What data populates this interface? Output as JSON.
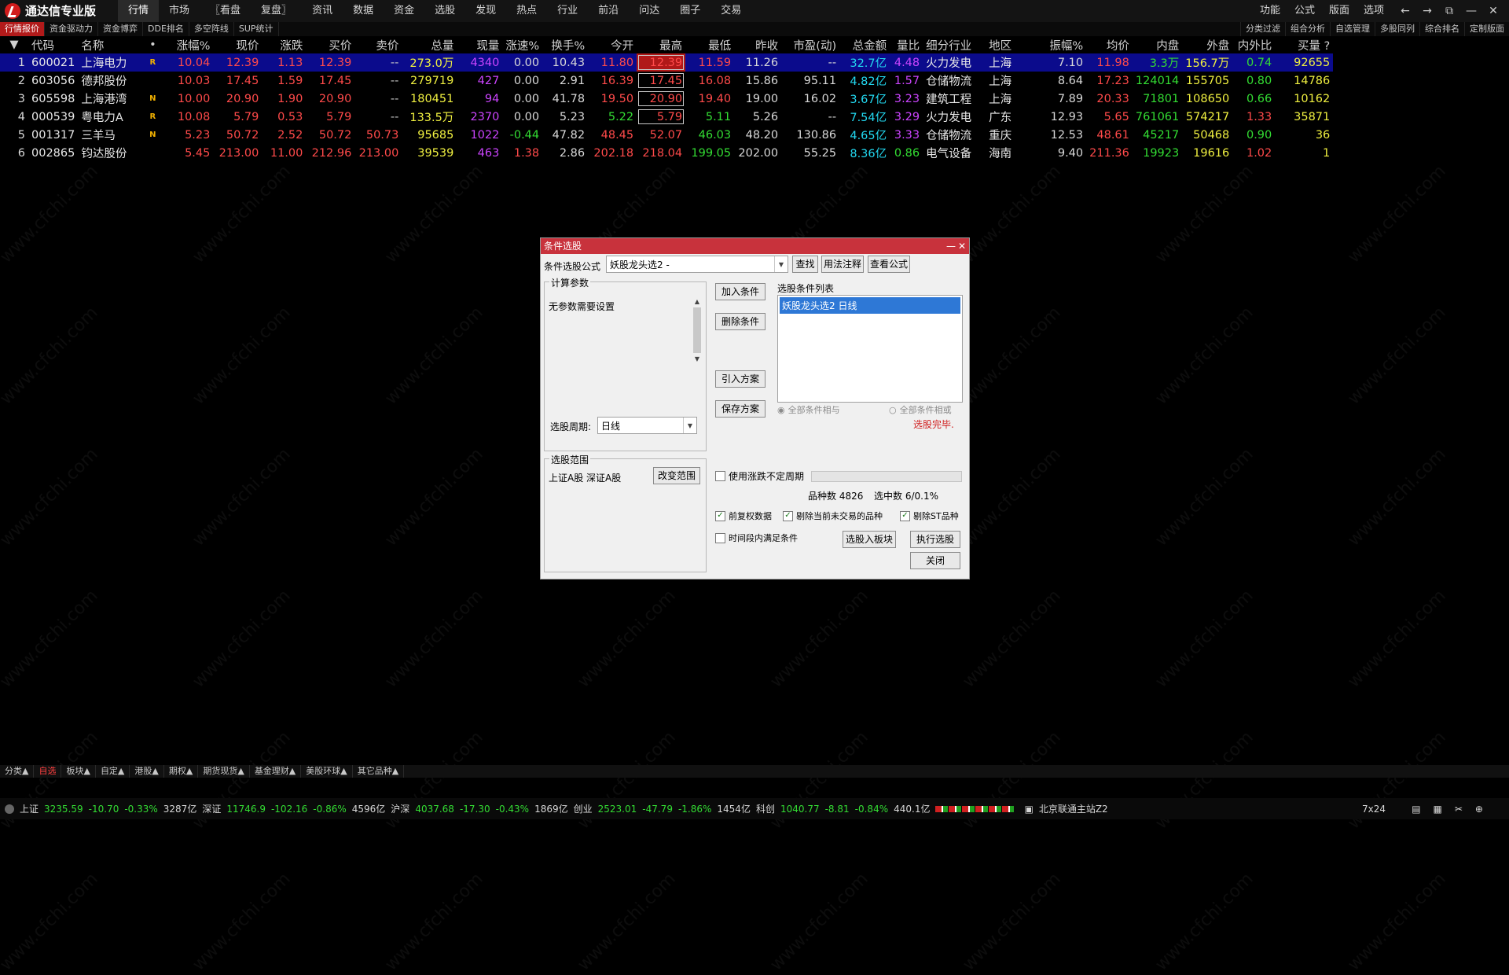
{
  "app": {
    "title": "通达信专业版"
  },
  "menu": [
    "行情",
    "市场",
    "〖看盘",
    "复盘〗",
    "资讯",
    "数据",
    "资金",
    "选股",
    "发现",
    "热点",
    "行业",
    "前沿",
    "问达",
    "圈子",
    "交易"
  ],
  "right_menu": [
    "功能",
    "公式",
    "版面",
    "选项"
  ],
  "window_buttons": [
    "←",
    "→",
    "⧉",
    "—",
    "✕"
  ],
  "tabs": [
    "行情报价",
    "资金驱动力",
    "资金博弈",
    "DDE排名",
    "多空阵线",
    "SUP统计"
  ],
  "right_tabs": [
    "分类过滤",
    "组合分析",
    "自选管理",
    "多股同列",
    "综合排名",
    "定制版面"
  ],
  "watermark": "www.cfchi.com",
  "table": {
    "headers": [
      "",
      "代码",
      "名称",
      "•",
      "涨幅%",
      "现价",
      "涨跌",
      "买价",
      "卖价",
      "总量",
      "现量",
      "涨速%",
      "换手%",
      "今开",
      "最高",
      "最低",
      "昨收",
      "市盈(动)",
      "总金额",
      "量比",
      "细分行业",
      "地区",
      "振幅%",
      "均价",
      "内盘",
      "外盘",
      "内外比",
      "买量 ?"
    ],
    "rows": [
      {
        "c": [
          "1",
          "600021",
          "上海电力",
          "R",
          "10.04",
          "12.39",
          "1.13",
          "12.39",
          "--",
          "273.0万",
          "4340",
          "0.00",
          "10.43",
          "11.80",
          "12.39",
          "11.59",
          "11.26",
          "--",
          "32.7亿",
          "4.48",
          "火力发电",
          "上海",
          "7.10",
          "11.98",
          "3.3万",
          "156.7万",
          "0.74",
          "92655"
        ]
      },
      {
        "c": [
          "2",
          "603056",
          "德邦股份",
          "",
          "10.03",
          "17.45",
          "1.59",
          "17.45",
          "--",
          "279719",
          "427",
          "0.00",
          "2.91",
          "16.39",
          "17.45",
          "16.08",
          "15.86",
          "95.11",
          "4.82亿",
          "1.57",
          "仓储物流",
          "上海",
          "8.64",
          "17.23",
          "124014",
          "155705",
          "0.80",
          "14786"
        ]
      },
      {
        "c": [
          "3",
          "605598",
          "上海港湾",
          "N",
          "10.00",
          "20.90",
          "1.90",
          "20.90",
          "--",
          "180451",
          "94",
          "0.00",
          "41.78",
          "19.50",
          "20.90",
          "19.40",
          "19.00",
          "16.02",
          "3.67亿",
          "3.23",
          "建筑工程",
          "上海",
          "7.89",
          "20.33",
          "71801",
          "108650",
          "0.66",
          "10162"
        ]
      },
      {
        "c": [
          "4",
          "000539",
          "粤电力A",
          "R",
          "10.08",
          "5.79",
          "0.53",
          "5.79",
          "--",
          "133.5万",
          "2370",
          "0.00",
          "5.23",
          "5.22",
          "5.79",
          "5.11",
          "5.26",
          "--",
          "7.54亿",
          "3.29",
          "火力发电",
          "广东",
          "12.93",
          "5.65",
          "761061",
          "574217",
          "1.33",
          "35871"
        ]
      },
      {
        "c": [
          "5",
          "001317",
          "三羊马",
          "N",
          "5.23",
          "50.72",
          "2.52",
          "50.72",
          "50.73",
          "95685",
          "1022",
          "-0.44",
          "47.82",
          "48.45",
          "52.07",
          "46.03",
          "48.20",
          "130.86",
          "4.65亿",
          "3.33",
          "仓储物流",
          "重庆",
          "12.53",
          "48.61",
          "45217",
          "50468",
          "0.90",
          "36"
        ]
      },
      {
        "c": [
          "6",
          "002865",
          "钧达股份",
          "",
          "5.45",
          "213.00",
          "11.00",
          "212.96",
          "213.00",
          "39539",
          "463",
          "1.38",
          "2.86",
          "202.18",
          "218.04",
          "199.05",
          "202.00",
          "55.25",
          "8.36亿",
          "0.86",
          "电气设备",
          "海南",
          "9.40",
          "211.36",
          "19923",
          "19616",
          "1.02",
          "1"
        ]
      }
    ]
  },
  "dialog": {
    "title": "条件选股",
    "formula_label": "条件选股公式",
    "formula_value": "妖股龙头选2  -",
    "find_btn": "查找",
    "usage_btn": "用法注释",
    "view_btn": "查看公式",
    "params_title": "计算参数",
    "params_text": "无参数需要设置",
    "add_btn": "加入条件",
    "del_btn": "删除条件",
    "import_btn": "引入方案",
    "save_btn": "保存方案",
    "list_title": "选股条件列表",
    "list_items": [
      "妖股龙头选2  日线"
    ],
    "radio_and": "全部条件相与",
    "radio_or": "全部条件相或",
    "done_text": "选股完毕.",
    "period_label": "选股周期:",
    "period_value": "日线",
    "range_title": "选股范围",
    "range_text": "上证A股 深证A股",
    "change_range_btn": "改变范围",
    "use_period_label": "使用涨跌不定周期",
    "count_text": "品种数 4826",
    "selected_text": "选中数 6/0.1%",
    "opt_prefq": "前复权数据",
    "opt_remove_untraded": "剔除当前未交易的品种",
    "opt_remove_st": "剔除ST品种",
    "opt_time_range": "时间段内满足条件",
    "to_block_btn": "选股入板块",
    "exec_btn": "执行选股",
    "close_btn": "关闭"
  },
  "bottom_tabs": [
    "分类▲",
    "自选",
    "板块▲",
    "自定▲",
    "港股▲",
    "期权▲",
    "期货现货▲",
    "基金理财▲",
    "美股环球▲",
    "其它品种▲"
  ],
  "status": {
    "sh_label": "上证",
    "sh_val": "3235.59",
    "sh_chg": "-10.70",
    "sh_pct": "-0.33%",
    "sh_amt": "3287亿",
    "sz_label": "深证",
    "sz_val": "11746.9",
    "sz_chg": "-102.16",
    "sz_pct": "-0.86%",
    "sz_amt": "4596亿",
    "hs_label": "沪深",
    "hs_val": "4037.68",
    "hs_chg": "-17.30",
    "hs_pct": "-0.43%",
    "hs_amt": "1869亿",
    "cy_label": "创业",
    "cy_val": "2523.01",
    "cy_chg": "-47.79",
    "cy_pct": "-1.86%",
    "cy_amt": "1454亿",
    "kc_label": "科创",
    "kc_val": "1040.77",
    "kc_chg": "-8.81",
    "kc_pct": "-0.84%",
    "kc_amt": "440.1亿",
    "server": "北京联通主站Z2",
    "clock": "7x24"
  }
}
